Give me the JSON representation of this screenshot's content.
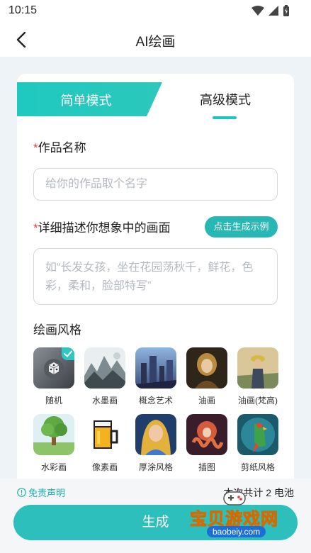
{
  "status_bar": {
    "time": "10:15"
  },
  "nav": {
    "title": "AI绘画"
  },
  "tabs": {
    "simple": "简单模式",
    "advanced": "高级模式"
  },
  "form": {
    "name_label": "作品名称",
    "name_placeholder": "给你的作品取个名字",
    "desc_label": "详细描述你想象中的画面",
    "example_button": "点击生成示例",
    "desc_placeholder": "如“长发女孩，坐在花园荡秋千，鲜花，色彩，柔和，脸部特写”",
    "required_mark": "*"
  },
  "styles": {
    "heading": "绘画风格",
    "items": [
      {
        "name": "随机",
        "selected": true
      },
      {
        "name": "水墨画"
      },
      {
        "name": "概念艺术"
      },
      {
        "name": "油画"
      },
      {
        "name": "油画(梵高)"
      },
      {
        "name": "水彩画"
      },
      {
        "name": "像素画"
      },
      {
        "name": "厚涂风格"
      },
      {
        "name": "插图"
      },
      {
        "name": "剪纸风格"
      }
    ]
  },
  "footer": {
    "disclaimer": "免责声明",
    "cost": "本次共计 2 电池",
    "generate_button": "生成"
  },
  "watermark": {
    "text": "宝贝游戏网",
    "url": "baobeiy.com"
  },
  "colors": {
    "accent": "#2cbfbb",
    "required": "#e53b3b"
  }
}
